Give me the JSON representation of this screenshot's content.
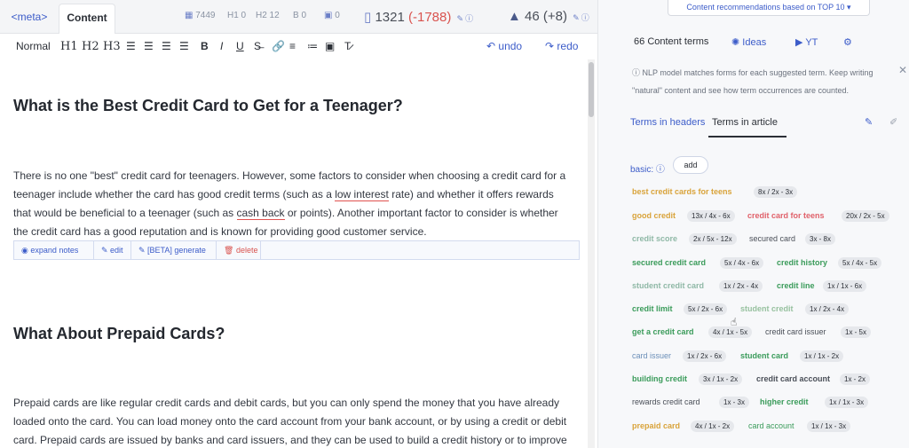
{
  "tabs": {
    "meta": "<meta>",
    "content": "Content"
  },
  "stats": {
    "words": "7449",
    "h1": "H1 0",
    "h2": "H2 12",
    "bold": "B 0",
    "images": "0",
    "score_main": "1321",
    "score_diff": "(-1788)",
    "grade_main": "46",
    "grade_diff": "(+8)"
  },
  "toolbar": {
    "style": "Normal",
    "h1": "H1",
    "h2": "H2",
    "h3": "H3",
    "bold": "B",
    "italic": "I",
    "underline": "U",
    "undo": "undo",
    "redo": "redo"
  },
  "editor": {
    "heading1": "What is the Best Credit Card to Get for a Teenager?",
    "para1": [
      "There is no one \"best\" credit card for teenagers. However, some factors to consider when choosing a credit card for a",
      "teenager include whether the card has good credit terms (such as a ",
      "low interest",
      " rate) and whether it offers rewards",
      "that would be beneficial to a teenager (such as ",
      "cash back",
      " or points). Another important factor to consider is whether",
      "the credit card has a good reputation and is known for providing good customer service."
    ],
    "notes": {
      "expand": "expand notes",
      "edit": "edit",
      "generate": "[BETA] generate",
      "delete": "delete"
    },
    "heading2": "What About Prepaid Cards?",
    "para2": [
      "Prepaid cards are like regular credit cards and debit cards, but you can only spend the money that you have already",
      "loaded onto the card. You can load money onto the card account from your bank account, or by using a credit or debit",
      "card. Prepaid cards are issued by banks and card issuers, and they can be used to build a credit history or to improve"
    ]
  },
  "panel": {
    "recommendations": "Content recommendations based on TOP 10",
    "tabs": {
      "terms": "Content terms",
      "ideas": "Ideas",
      "yt": "YT"
    },
    "info_line1": "NLP model matches forms for each suggested term. Keep writing",
    "info_line2": "\"natural\" content and see how term occurrences are counted.",
    "subtabs": {
      "headers": "Terms in headers",
      "article": "Terms in article"
    },
    "basic_label": "basic:",
    "add": "add",
    "terms": [
      {
        "term": "best credit cards for teens",
        "count": "8x / 2x - 3x"
      },
      {
        "term": "good credit",
        "count": "13x / 4x - 6x"
      },
      {
        "term": "credit card for teens",
        "count": "20x / 2x - 5x"
      },
      {
        "term": "credit score",
        "count": "2x / 5x - 12x"
      },
      {
        "term": "secured card",
        "count": "3x - 8x"
      },
      {
        "term": "secured credit card",
        "count": "5x / 4x - 6x"
      },
      {
        "term": "credit history",
        "count": "5x / 4x - 5x"
      },
      {
        "term": "student credit card",
        "count": "1x / 2x - 4x"
      },
      {
        "term": "credit line",
        "count": "1x / 1x - 6x"
      },
      {
        "term": "credit limit",
        "count": "5x / 2x - 6x"
      },
      {
        "term": "student credit",
        "count": "1x / 2x - 4x"
      },
      {
        "term": "get a credit card",
        "count": "4x / 1x - 5x"
      },
      {
        "term": "credit card issuer",
        "count": "1x - 5x"
      },
      {
        "term": "card issuer",
        "count": "1x / 2x - 6x"
      },
      {
        "term": "student card",
        "count": "1x / 1x - 2x"
      },
      {
        "term": "building credit",
        "count": "3x / 1x - 2x"
      },
      {
        "term": "credit card account",
        "count": "1x - 2x"
      },
      {
        "term": "rewards credit card",
        "count": "1x - 3x"
      },
      {
        "term": "higher credit",
        "count": "1x / 1x - 3x"
      },
      {
        "term": "prepaid card",
        "count": "4x / 1x - 2x"
      },
      {
        "term": "card account",
        "count": "1x / 1x - 3x"
      }
    ]
  }
}
